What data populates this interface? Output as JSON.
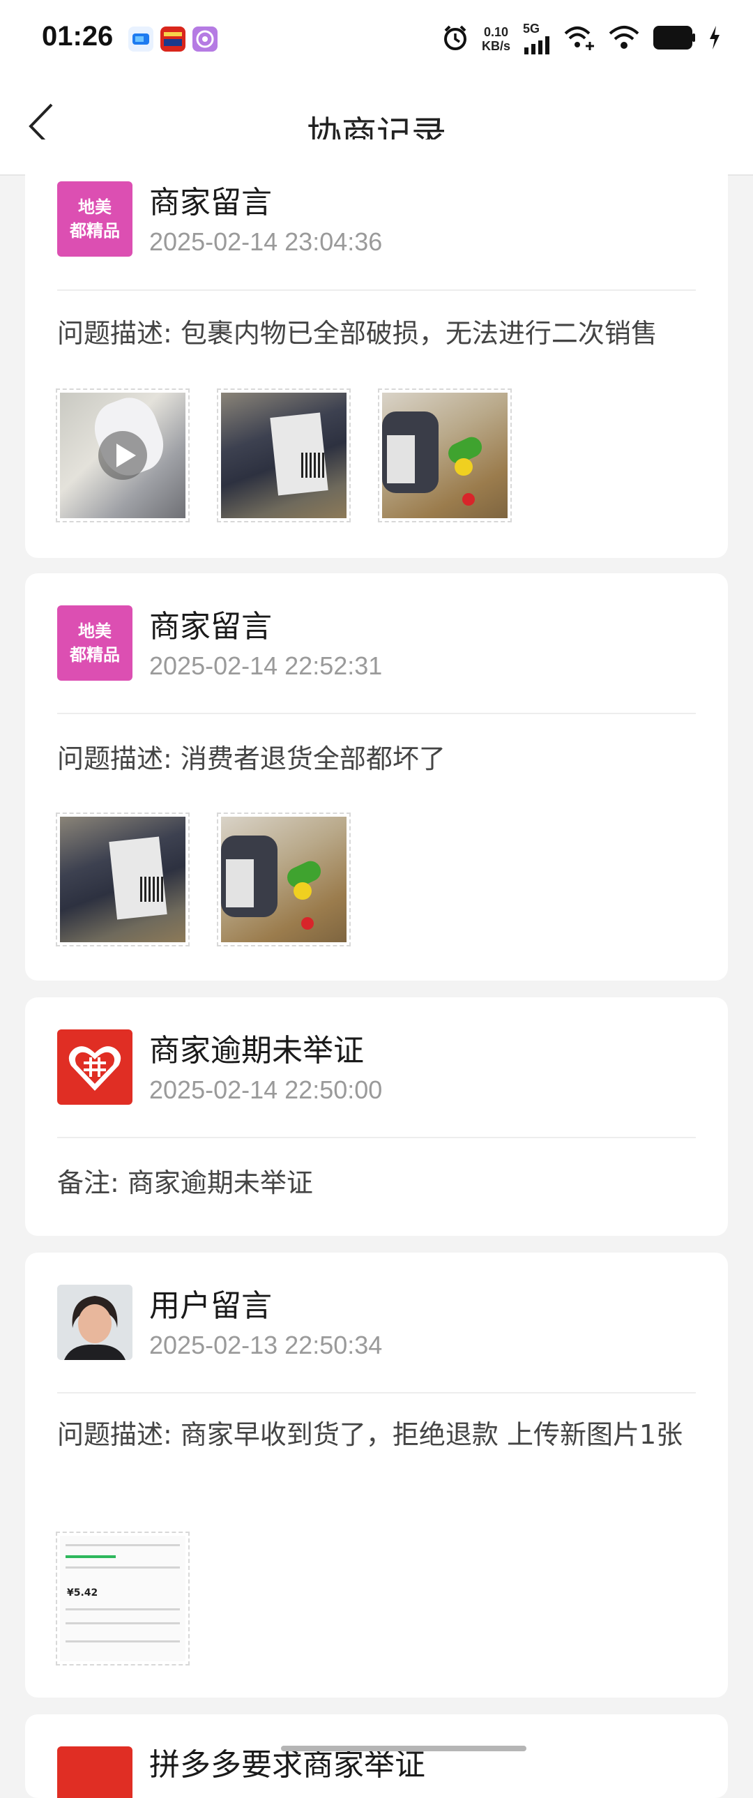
{
  "status_bar": {
    "time": "01:26",
    "net_speed_value": "0.10",
    "net_speed_unit": "KB/s",
    "network_type": "5G",
    "app_icons": [
      "cloud-app-icon",
      "news-app-icon",
      "purple-app-icon"
    ],
    "right_icons": [
      "alarm-icon",
      "signal-icon",
      "wifi-plus-icon",
      "wifi-icon",
      "battery-icon",
      "charging-icon"
    ]
  },
  "header": {
    "title": "协商记录",
    "back_icon": "back-chevron-icon"
  },
  "records": [
    {
      "avatar_type": "brand",
      "avatar_text_line1": "地美",
      "avatar_text_line2": "都精品",
      "title": "商家留言",
      "time": "2025-02-14 23:04:36",
      "desc": "问题描述: 包裹内物已全部破损，无法进行二次销售",
      "attachments": [
        "video",
        "package-photo",
        "toys-photo"
      ]
    },
    {
      "avatar_type": "brand",
      "avatar_text_line1": "地美",
      "avatar_text_line2": "都精品",
      "title": "商家留言",
      "time": "2025-02-14 22:52:31",
      "desc": "问题描述: 消费者退货全部都坏了",
      "attachments": [
        "package-photo",
        "toys-photo"
      ]
    },
    {
      "avatar_type": "platform",
      "title": "商家逾期未举证",
      "time": "2025-02-14 22:50:00",
      "desc": "备注: 商家逾期未举证",
      "attachments": []
    },
    {
      "avatar_type": "user",
      "title": "用户留言",
      "time": "2025-02-13 22:50:34",
      "desc": "问题描述: 商家早收到货了，拒绝退款 上传新图片1张",
      "attachments": [
        "screenshot"
      ],
      "screenshot_price": "¥5.42"
    },
    {
      "avatar_type": "platform",
      "title": "拼多多要求商家举证"
    }
  ],
  "colors": {
    "brand_avatar": "#dc4fb2",
    "platform_red": "#e02e24",
    "time_gray": "#9a9a9a",
    "background": "#f3f3f3"
  }
}
